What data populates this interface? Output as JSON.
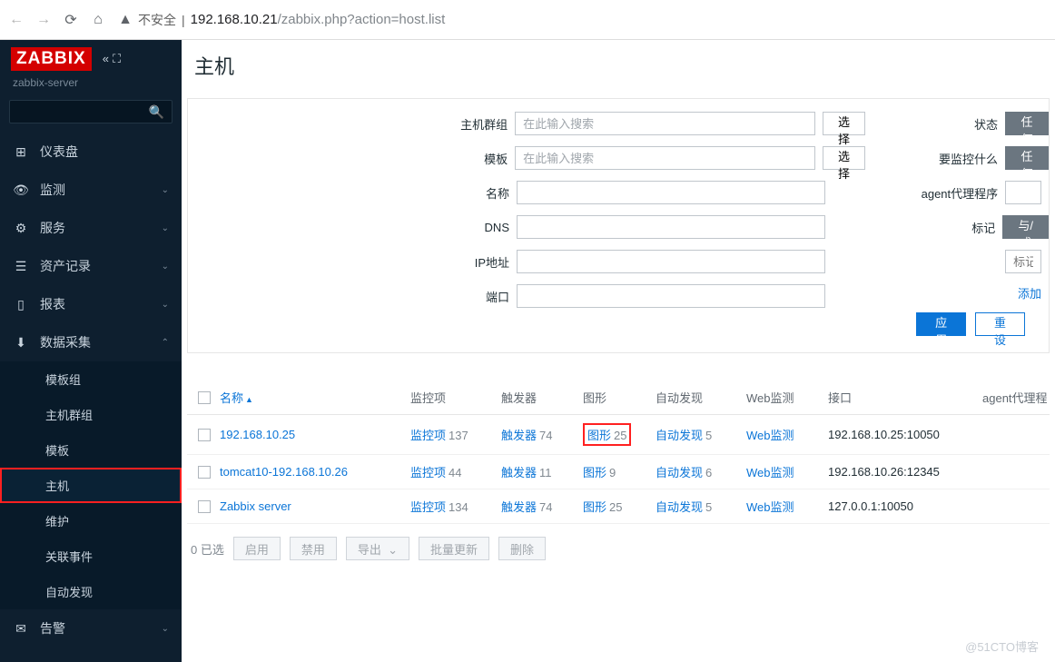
{
  "url": {
    "security": "不安全",
    "host": "192.168.10.21",
    "path": "/zabbix.php?action=host.list"
  },
  "logo": "ZABBIX",
  "server_name": "zabbix-server",
  "nav": {
    "dashboard": "仪表盘",
    "monitoring": "监测",
    "services": "服务",
    "inventory": "资产记录",
    "reports": "报表",
    "collect": "数据采集",
    "alerts": "告警"
  },
  "sub": {
    "template_group": "模板组",
    "host_group": "主机群组",
    "templates": "模板",
    "hosts": "主机",
    "maintenance": "维护",
    "correlation": "关联事件",
    "discovery": "自动发现"
  },
  "page_title": "主机",
  "filter": {
    "host_groups": "主机群组",
    "templates": "模板",
    "name": "名称",
    "dns": "DNS",
    "ip": "IP地址",
    "port": "端口",
    "placeholder_search": "在此输入搜索",
    "select": "选择",
    "status": "状态",
    "monitored_by": "要监控什么",
    "agent_proxy": "agent代理程序",
    "tags": "标记",
    "any": "任何",
    "andor": "与/或",
    "tag_placeholder": "标记",
    "add": "添加",
    "apply": "应用",
    "reset": "重设"
  },
  "columns": {
    "name": "名称",
    "items": "监控项",
    "triggers": "触发器",
    "graphs": "图形",
    "discovery": "自动发现",
    "web": "Web监测",
    "interface": "接口",
    "proxy": "agent代理程"
  },
  "rows": [
    {
      "name": "192.168.10.25",
      "items": 137,
      "triggers": 74,
      "graphs": 25,
      "discovery": 5,
      "web": "Web监测",
      "interface": "192.168.10.25:10050",
      "highlight_graphs": true
    },
    {
      "name": "tomcat10-192.168.10.26",
      "items": 44,
      "triggers": 11,
      "graphs": 9,
      "discovery": 6,
      "web": "Web监测",
      "interface": "192.168.10.26:12345"
    },
    {
      "name": "Zabbix server",
      "items": 134,
      "triggers": 74,
      "graphs": 25,
      "discovery": 5,
      "web": "Web监测",
      "interface": "127.0.0.1:10050"
    }
  ],
  "footer": {
    "selected": "0 已选",
    "enable": "启用",
    "disable": "禁用",
    "export": "导出",
    "mass_update": "批量更新",
    "delete": "删除"
  },
  "watermark": "@51CTO博客"
}
